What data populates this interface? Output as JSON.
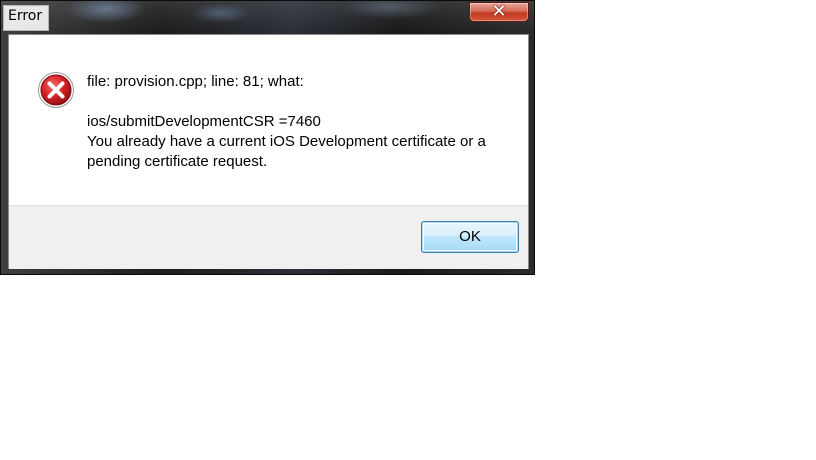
{
  "window": {
    "title": "Error",
    "close_glyph": "✕"
  },
  "dialog": {
    "icon": "error-icon",
    "message_lines": [
      "file: provision.cpp; line: 81; what:",
      "",
      "ios/submitDevelopmentCSR =7460",
      "You already have a current iOS Development certificate or a",
      "pending certificate request."
    ],
    "ok_label": "OK"
  },
  "colors": {
    "error_red": "#d21f26",
    "button_border": "#3c7fb1",
    "footer_bg": "#f0f0f0"
  }
}
